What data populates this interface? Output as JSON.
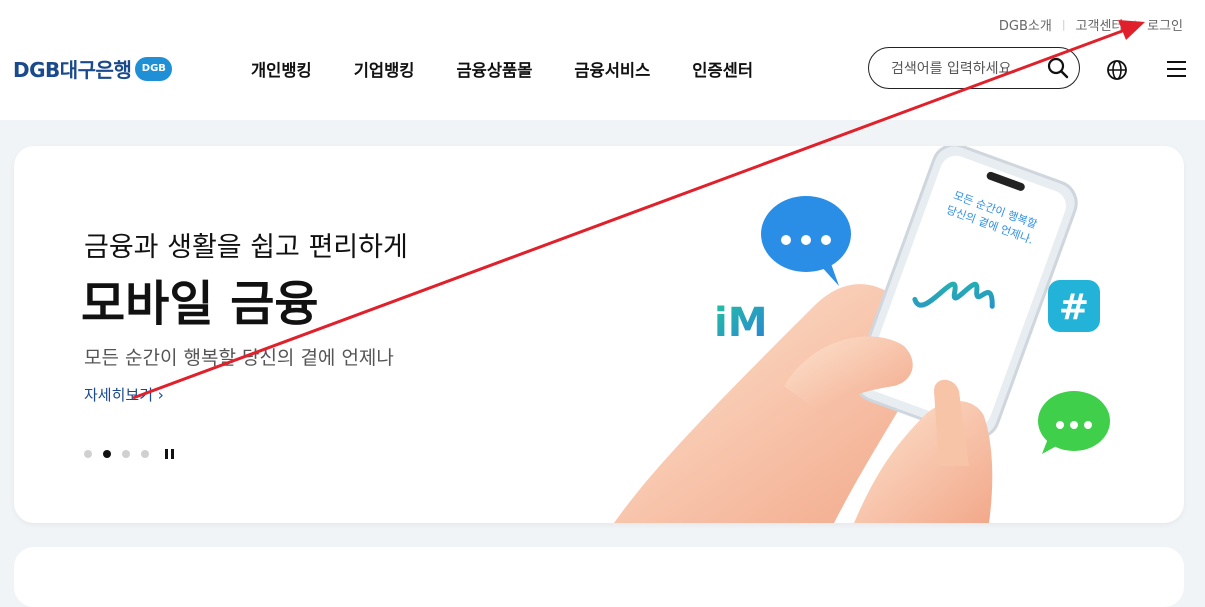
{
  "util_links": [
    "DGB소개",
    "고객센터",
    "로그인"
  ],
  "logo": {
    "name": "DGB대구은행",
    "badge": "DGB"
  },
  "gnb": [
    "개인뱅킹",
    "기업뱅킹",
    "금융상품몰",
    "금융서비스",
    "인증센터"
  ],
  "search": {
    "placeholder": "검색어를 입력하세요."
  },
  "banner": {
    "subtitle": "금융과 생활을 쉽고 편리하게",
    "title": "모바일 금융",
    "description": "모든 순간이 행복할 당신의 곁에 언제나",
    "more_link": "자세히보기",
    "phone_text": [
      "모든 순간이 행복할",
      "당신의 곁에 언제나."
    ],
    "app_logo": "iM",
    "active_slide": 2,
    "slide_count": 4
  },
  "colors": {
    "brand": "#1a4a8c",
    "accent": "#1f8fd6",
    "annotation": "#e0202a"
  }
}
